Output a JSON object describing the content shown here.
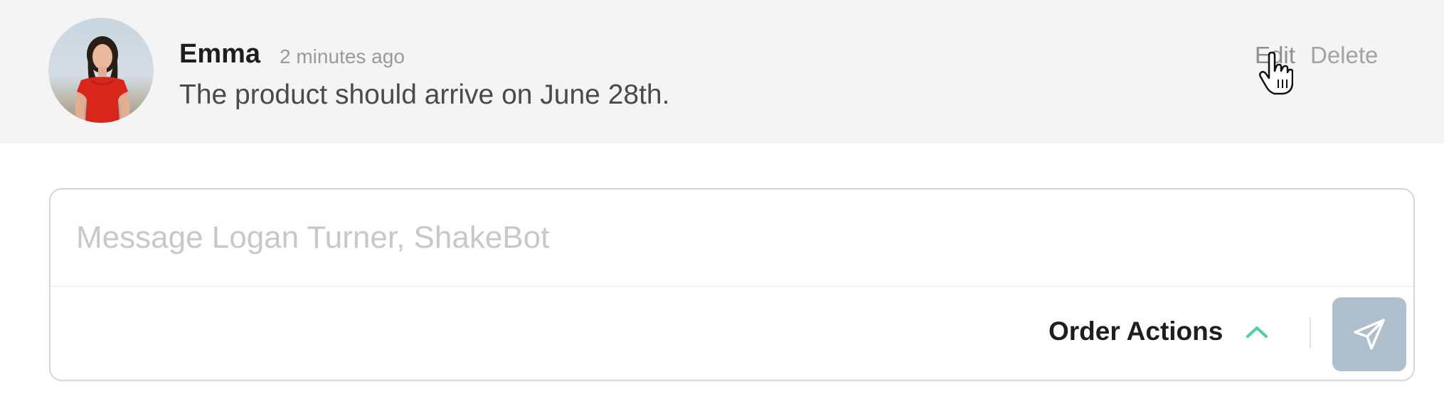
{
  "message": {
    "author": "Emma",
    "timestamp": "2 minutes ago",
    "text": "The product should arrive on June 28th.",
    "actions": {
      "edit_label": "Edit",
      "delete_label": "Delete"
    }
  },
  "composer": {
    "placeholder": "Message Logan Turner, ShakeBot",
    "order_actions_label": "Order Actions",
    "send_icon": "paper-plane-icon"
  },
  "colors": {
    "message_background": "#f4f4f4",
    "chevron_accent": "#4fcf9d",
    "send_button": "#aebfcd"
  }
}
